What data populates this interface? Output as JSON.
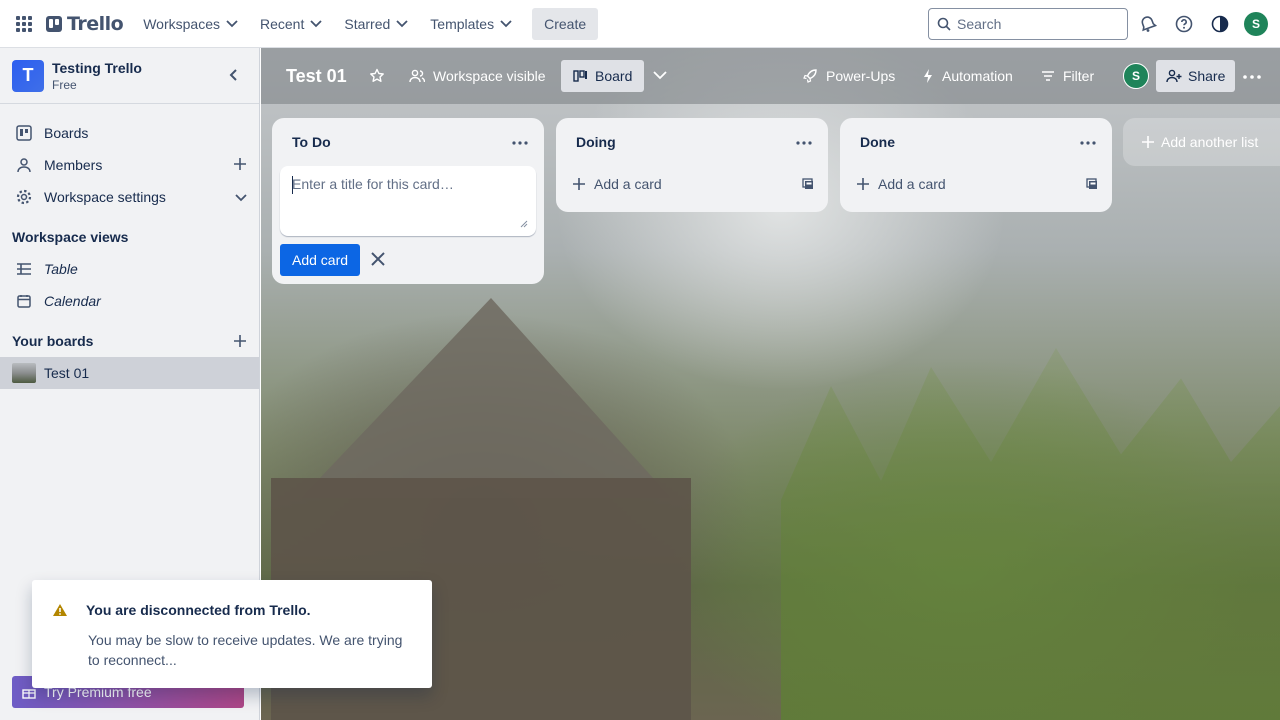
{
  "topbar": {
    "logo_text": "Trello",
    "nav": [
      {
        "label": "Workspaces"
      },
      {
        "label": "Recent"
      },
      {
        "label": "Starred"
      },
      {
        "label": "Templates"
      }
    ],
    "create_label": "Create",
    "search_placeholder": "Search",
    "avatar_initial": "S"
  },
  "sidebar": {
    "workspace_initial": "T",
    "workspace_name": "Testing Trello",
    "workspace_plan": "Free",
    "items": [
      {
        "label": "Boards"
      },
      {
        "label": "Members"
      },
      {
        "label": "Workspace settings"
      }
    ],
    "views_heading": "Workspace views",
    "views": [
      {
        "label": "Table"
      },
      {
        "label": "Calendar"
      }
    ],
    "boards_heading": "Your boards",
    "boards": [
      {
        "label": "Test 01"
      }
    ],
    "premium_label": "Try Premium free"
  },
  "board": {
    "title": "Test 01",
    "visibility": "Workspace visible",
    "view_label": "Board",
    "powerups": "Power-Ups",
    "automation": "Automation",
    "filter": "Filter",
    "member_initial": "S",
    "share": "Share",
    "lists": [
      {
        "title": "To Do"
      },
      {
        "title": "Doing",
        "add_label": "Add a card"
      },
      {
        "title": "Done",
        "add_label": "Add a card"
      }
    ],
    "card_placeholder": "Enter a title for this card…",
    "add_card_button": "Add card",
    "add_list_label": "Add another list"
  },
  "toast": {
    "title": "You are disconnected from Trello.",
    "body": "You may be slow to receive updates. We are trying to reconnect..."
  }
}
